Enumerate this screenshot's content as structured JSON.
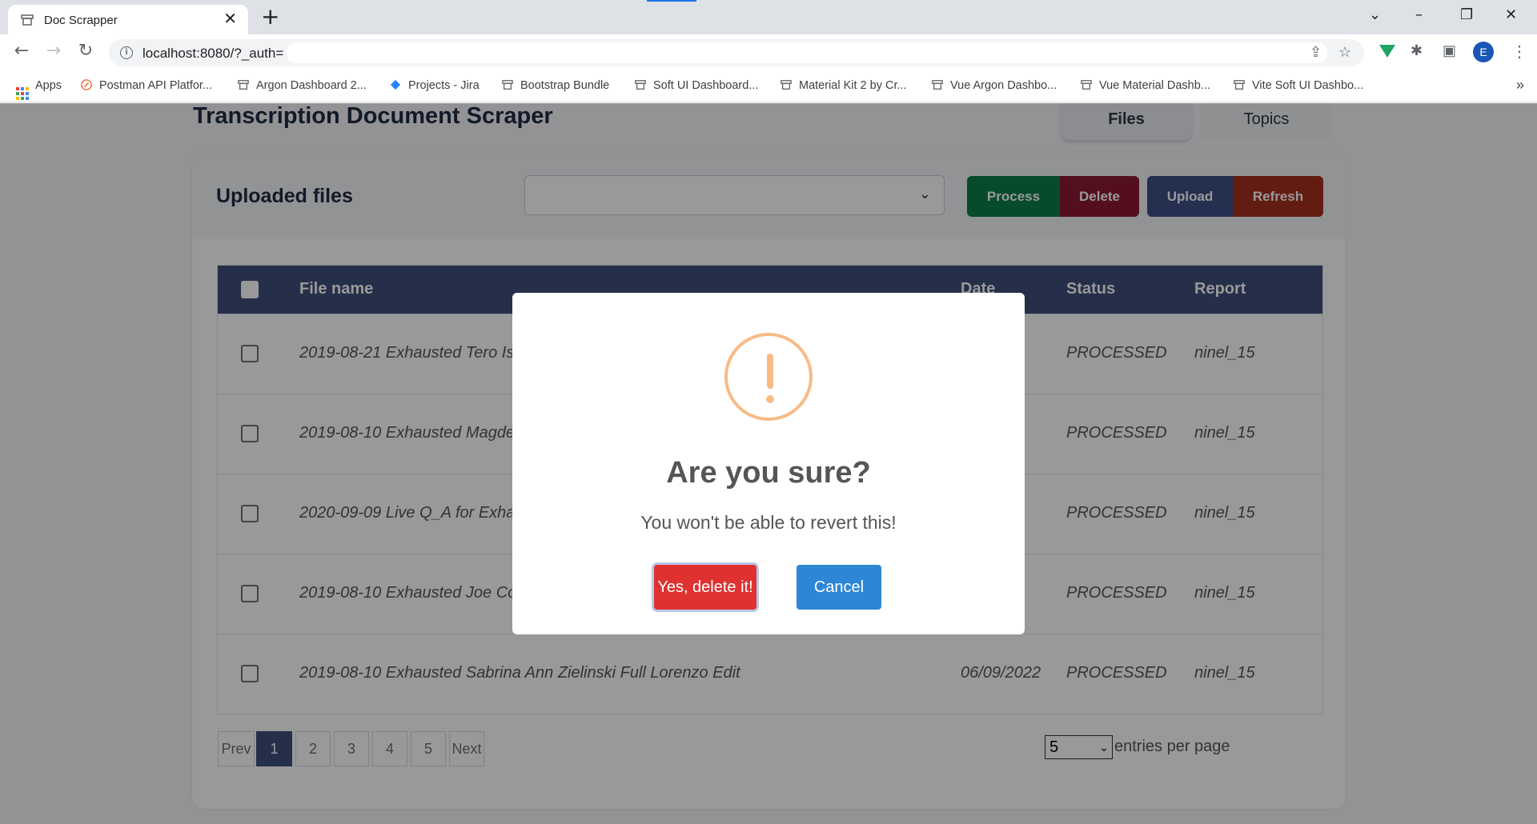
{
  "browser": {
    "tab_title": "Doc Scrapper",
    "url": "localhost:8080/?_auth=",
    "avatar_letter": "E",
    "bookmarks": [
      "Apps",
      "Postman API Platfor...",
      "Argon Dashboard 2...",
      "Projects - Jira",
      "Bootstrap Bundle",
      "Soft UI Dashboard...",
      "Material Kit 2 by Cr...",
      "Vue Argon Dashbo...",
      "Vue Material Dashb...",
      "Vite Soft UI Dashbo..."
    ],
    "bookmarks_more": "»"
  },
  "app": {
    "title": "Transcription Document Scraper",
    "nav_tabs": [
      "Files",
      "Topics"
    ]
  },
  "files_card": {
    "title": "Uploaded files",
    "select_value": "",
    "buttons": {
      "process": "Process",
      "delete": "Delete",
      "upload": "Upload",
      "refresh": "Refresh"
    }
  },
  "table": {
    "headers": [
      "File name",
      "Date",
      "Status",
      "Report"
    ],
    "rows": [
      {
        "file_name": "2019-08-21 Exhausted Tero Is",
        "date": "",
        "status": "PROCESSED",
        "report": "ninel_15"
      },
      {
        "file_name": "2019-08-10 Exhausted Magde",
        "date": "",
        "status": "PROCESSED",
        "report": "ninel_15"
      },
      {
        "file_name": "2020-09-09 Live Q_A for Exha",
        "date": "",
        "status": "PROCESSED",
        "report": "ninel_15"
      },
      {
        "file_name": "2019-08-10 Exhausted Joe Co",
        "date": "",
        "status": "PROCESSED",
        "report": "ninel_15"
      },
      {
        "file_name": "2019-08-10 Exhausted Sabrina Ann Zielinski Full Lorenzo Edit",
        "date": "06/09/2022",
        "status": "PROCESSED",
        "report": "ninel_15"
      }
    ]
  },
  "pagination": {
    "prev": "Prev",
    "pages": [
      "1",
      "2",
      "3",
      "4",
      "5"
    ],
    "active_page": "1",
    "next": "Next",
    "per_page_value": "5",
    "per_page_label": "entries per page"
  },
  "modal": {
    "icon": "warning-icon",
    "title": "Are you sure?",
    "text": "You won't be able to revert this!",
    "confirm": "Yes, delete it!",
    "cancel": "Cancel"
  },
  "colors": {
    "table_header": "#3e4f7c",
    "process": "#0a7d4a",
    "delete": "#8a1a33",
    "upload": "#3e4f86",
    "refresh": "#a4301f",
    "confirm": "#e03131",
    "cancel": "#2d86d6",
    "warning": "#f8bb86"
  }
}
